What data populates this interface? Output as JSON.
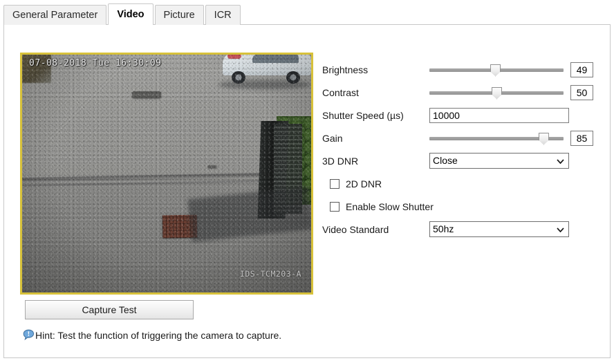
{
  "tabs": [
    {
      "label": "General Parameter",
      "active": false
    },
    {
      "label": "Video",
      "active": true
    },
    {
      "label": "Picture",
      "active": false
    },
    {
      "label": "ICR",
      "active": false
    }
  ],
  "video_preview": {
    "timestamp_overlay": "07-08-2018 Tue 16:30:09",
    "model_watermark": "IDS-TCM203-A",
    "border_color": "#d7c13a"
  },
  "capture_button": {
    "label": "Capture Test"
  },
  "hint": {
    "icon": "speech-bubble-info-icon",
    "text": "Hint: Test the function of triggering the camera to capture."
  },
  "settings": {
    "brightness": {
      "label": "Brightness",
      "value": "49",
      "percent": 49
    },
    "contrast": {
      "label": "Contrast",
      "value": "50",
      "percent": 50
    },
    "shutter_speed": {
      "label": "Shutter Speed (µs)",
      "value": "10000",
      "placeholder": ""
    },
    "gain": {
      "label": "Gain",
      "value": "85",
      "percent": 85
    },
    "dnr_3d": {
      "label": "3D DNR",
      "value": "Close"
    },
    "dnr_2d": {
      "label": "2D DNR",
      "checked": false
    },
    "slow_shutter": {
      "label": "Enable Slow Shutter",
      "checked": false
    },
    "video_standard": {
      "label": "Video Standard",
      "value": "50hz"
    }
  }
}
